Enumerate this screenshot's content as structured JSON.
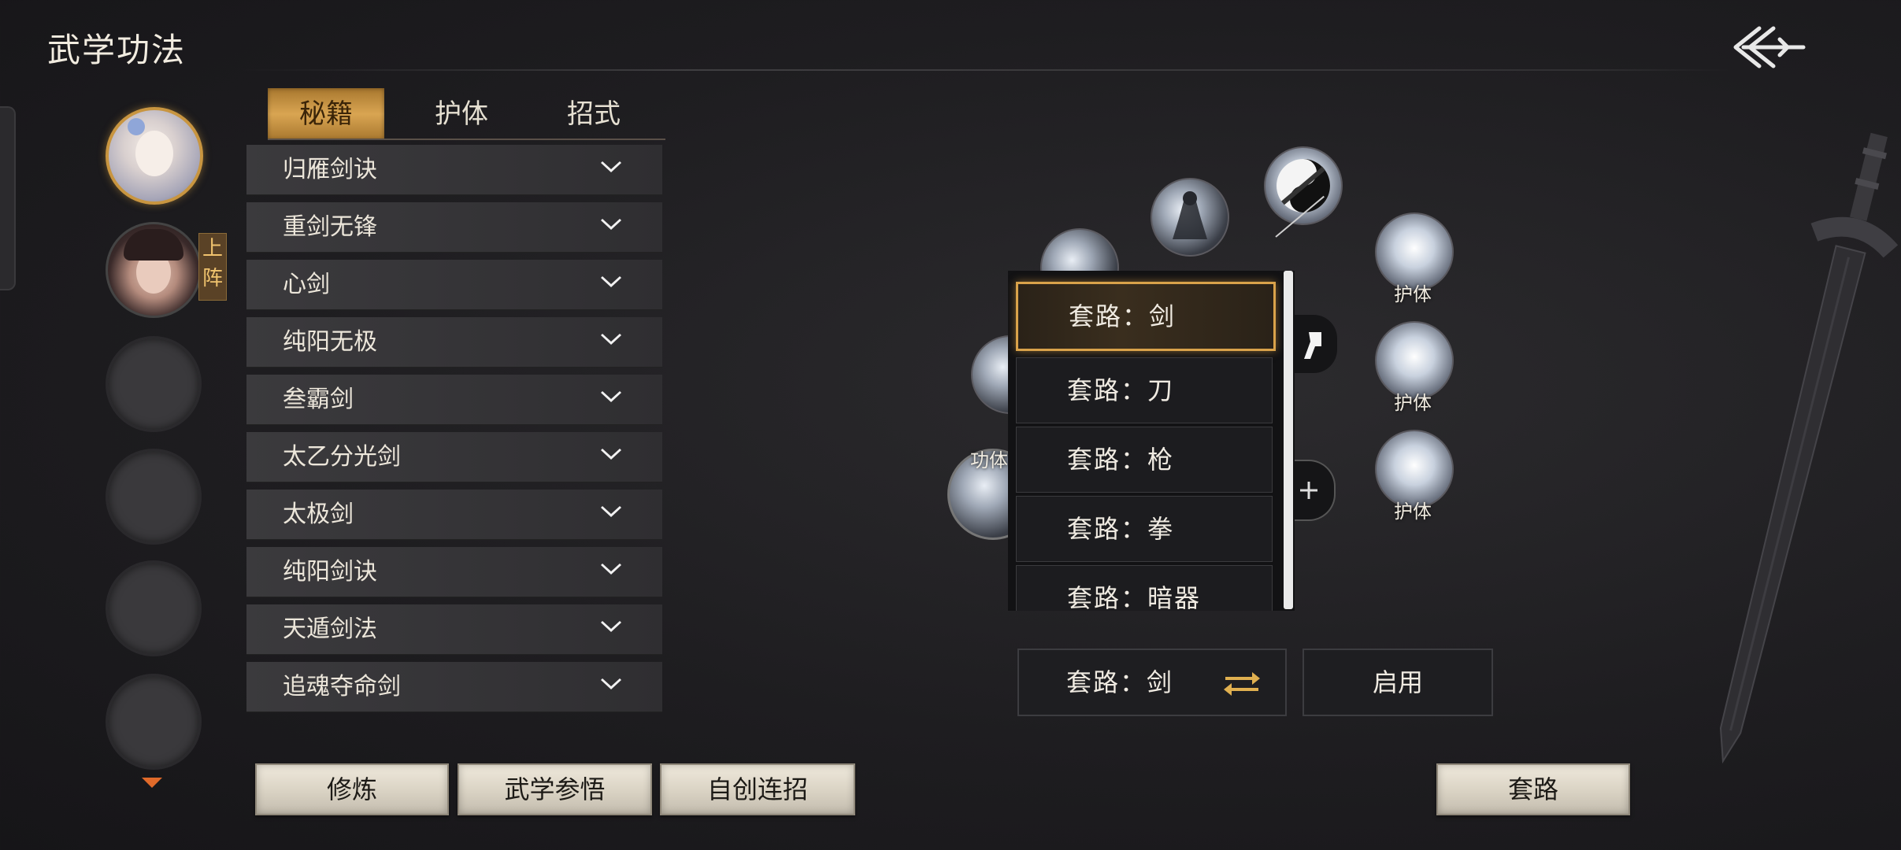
{
  "header": {
    "title": "武学功法"
  },
  "party": {
    "onboard_tag": "上阵",
    "slots": [
      "occupied-selected",
      "occupied",
      "empty",
      "empty",
      "empty",
      "empty"
    ]
  },
  "tabs": [
    {
      "label": "秘籍",
      "active": true
    },
    {
      "label": "护体",
      "active": false
    },
    {
      "label": "招式",
      "active": false
    }
  ],
  "skills": [
    {
      "label": "归雁剑诀"
    },
    {
      "label": "重剑无锋"
    },
    {
      "label": "心剑"
    },
    {
      "label": "纯阳无极"
    },
    {
      "label": "叁霸剑"
    },
    {
      "label": "太乙分光剑"
    },
    {
      "label": "太极剑"
    },
    {
      "label": "纯阳剑诀"
    },
    {
      "label": "天遁剑法"
    },
    {
      "label": "追魂夺命剑"
    }
  ],
  "graph": {
    "orb_labels": {
      "right_top": "护体",
      "right_mid": "护体",
      "right_bottom": "护体",
      "left": "功体"
    }
  },
  "dropdown": {
    "items": [
      {
        "label": "套路：剑",
        "selected": true
      },
      {
        "label": "套路：刀",
        "selected": false
      },
      {
        "label": "套路：枪",
        "selected": false
      },
      {
        "label": "套路：拳",
        "selected": false
      },
      {
        "label": "套路：暗器",
        "selected": false
      }
    ]
  },
  "controls": {
    "current_style": "套路：剑",
    "enable_label": "启用"
  },
  "bottom_buttons": {
    "practice": "修炼",
    "insight": "武学参悟",
    "combo": "自创连招",
    "style": "套路"
  },
  "colors": {
    "accent_gold": "#d9a24a",
    "tab_active": "#d9a552",
    "scroll_arrow": "#e06a2a"
  }
}
